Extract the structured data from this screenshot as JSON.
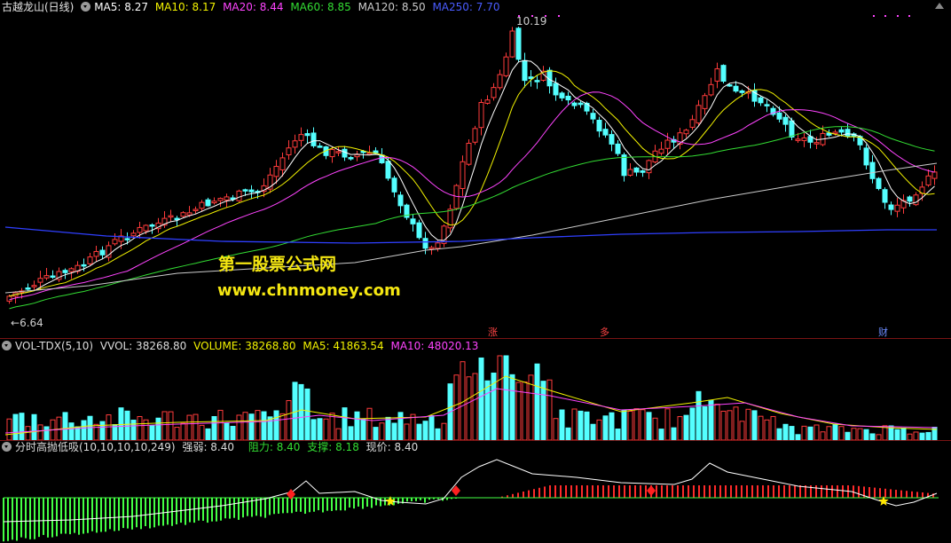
{
  "price_header": {
    "title": "古越龙山(日线)",
    "ma5": "MA5: 8.27",
    "ma10": "MA10: 8.17",
    "ma20": "MA20: 8.44",
    "ma60": "MA60: 8.85",
    "ma120": "MA120: 8.50",
    "ma250": "MA250: 7.70"
  },
  "price_labels": {
    "high": "10.19",
    "low": "6.64",
    "low_arrow": "←"
  },
  "events": {
    "e1": "涨",
    "e2": "多",
    "e3": "财"
  },
  "watermark": {
    "line1": "第一股票公式网",
    "line2": "www.chnmoney.com"
  },
  "vol_header": {
    "name": "VOL-TDX(5,10)",
    "vvol": "VVOL: 38268.80",
    "volume": "VOLUME: 38268.80",
    "ma5": "MA5: 41863.54",
    "ma10": "MA10: 48020.13"
  },
  "ind_header": {
    "name": "分时高抛低吸(10,10,10,10,249)",
    "strength": "强弱: 8.40",
    "resistance": "阻力: 8.40",
    "support": "支撑: 8.18",
    "current": "现价: 8.40"
  },
  "colors": {
    "up": "#ff3b3b",
    "down": "#54ffff",
    "ma5": "#ffffff",
    "ma10": "#f2f200",
    "ma20": "#ff44ff",
    "ma60": "#33dd33",
    "ma120": "#cccccc",
    "ma250": "#2f3fff",
    "bg": "#000000"
  },
  "icons": {
    "panel_toggle": "gear-icon",
    "collapse": "collapse-icon"
  }
}
